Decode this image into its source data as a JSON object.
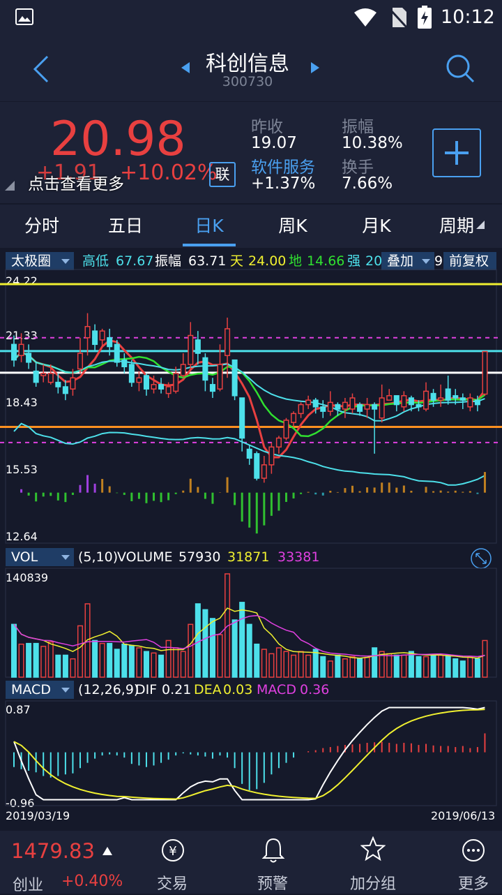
{
  "status": {
    "time": "10:12"
  },
  "header": {
    "title": "科创信息",
    "code": "300730"
  },
  "quote": {
    "price": "20.98",
    "change": "+1.91",
    "change_pct": "+10.02%",
    "hint": "点击查看更多",
    "lian_badge": "联",
    "prev_close_label": "昨收",
    "prev_close": "19.07",
    "amplitude_label": "振幅",
    "amplitude": "10.38%",
    "sector": "软件服务",
    "sector_change": "+1.37%",
    "turnover_label": "换手",
    "turnover": "7.66%"
  },
  "tabs": [
    "分时",
    "五日",
    "日K",
    "周K",
    "月K",
    "周期"
  ],
  "active_tab": "日K",
  "indicator_bar": {
    "selector": "太极圈",
    "hilo_label": "高低",
    "hilo": "67.67",
    "amp_label": "振幅",
    "amp": "63.71",
    "tian_label": "天",
    "tian": "24.00",
    "di_label": "地",
    "di": "14.66",
    "qiang_label": "强",
    "qiang": "20",
    "overlay": "叠加",
    "overlay_tail": "9.",
    "fuquan": "前复权"
  },
  "colors": {
    "up": "#e84040",
    "down": "#4de0ea",
    "accent": "#4aa0f0",
    "bg": "#15192a",
    "panel": "#1d2236"
  },
  "main_chart": {
    "y_labels": [
      "24.22",
      "21.33",
      "18.43",
      "15.53",
      "12.64"
    ],
    "level_lines": [
      {
        "value": 24.0,
        "color": "#f0f030"
      },
      {
        "value": 21.0,
        "color": "#4de0ea"
      },
      {
        "value": 20.03,
        "color": "#ffffff"
      },
      {
        "value": 17.6,
        "color": "#ff9020"
      },
      {
        "value": 21.6,
        "color": "#e040e0",
        "dashed": true
      },
      {
        "value": 16.9,
        "color": "#e040e0",
        "dashed": true
      }
    ],
    "ylim": [
      12.64,
      24.22
    ]
  },
  "volume": {
    "selector": "VOL",
    "params": "(5,10)",
    "label": "VOLUME",
    "value": "57930",
    "ma5": "31871",
    "ma10": "33381",
    "y_top": "140839"
  },
  "macd": {
    "selector": "MACD",
    "params": "(12,26,9)",
    "dif_label": "DIF",
    "dif": "0.21",
    "dea_label": "DEA",
    "dea": "0.03",
    "macd_label": "MACD",
    "macd": "0.36",
    "y_top": "0.87",
    "y_bottom": "-0.96",
    "start_date": "2019/03/19",
    "end_date": "2019/06/13"
  },
  "chart_data": {
    "type": "candlestick",
    "start_date": "2019/03/19",
    "end_date": "2019/06/13",
    "ylim": [
      12.64,
      24.22
    ],
    "candles": [
      [
        21.3,
        20.6,
        21.7,
        20.3
      ],
      [
        20.8,
        21.3,
        21.8,
        20.5
      ],
      [
        20.9,
        20.5,
        21.3,
        20.2
      ],
      [
        20.1,
        19.6,
        20.5,
        19.4
      ],
      [
        19.9,
        20.0,
        20.4,
        19.6
      ],
      [
        19.6,
        20.0,
        20.4,
        19.5
      ],
      [
        19.6,
        19.4,
        20.0,
        19.1
      ],
      [
        19.4,
        19.1,
        19.7,
        18.8
      ],
      [
        19.3,
        19.8,
        20.2,
        19.0
      ],
      [
        20.2,
        20.9,
        21.6,
        20.0
      ],
      [
        21.6,
        22.1,
        22.7,
        20.8
      ],
      [
        21.9,
        21.3,
        22.2,
        21.0
      ],
      [
        21.5,
        21.9,
        22.0,
        21.2
      ],
      [
        21.6,
        21.2,
        22.0,
        20.8
      ],
      [
        21.3,
        20.5,
        21.5,
        20.3
      ],
      [
        20.6,
        20.3,
        20.9,
        20.0
      ],
      [
        20.4,
        19.6,
        20.6,
        19.4
      ],
      [
        19.6,
        19.8,
        20.1,
        19.2
      ],
      [
        19.9,
        19.3,
        20.0,
        19.0
      ],
      [
        19.3,
        19.5,
        19.9,
        19.1
      ],
      [
        19.5,
        19.3,
        19.8,
        19.1
      ],
      [
        19.1,
        19.4,
        19.6,
        18.9
      ],
      [
        19.2,
        20.0,
        20.3,
        19.1
      ],
      [
        19.9,
        20.4,
        20.9,
        19.8
      ],
      [
        20.4,
        21.7,
        22.3,
        20.2
      ],
      [
        21.5,
        20.9,
        21.9,
        20.4
      ],
      [
        20.7,
        19.7,
        20.9,
        19.2
      ],
      [
        19.5,
        19.2,
        19.8,
        18.9
      ],
      [
        19.3,
        20.4,
        21.3,
        19.2
      ],
      [
        20.8,
        22.0,
        22.5,
        19.8
      ],
      [
        20.6,
        19.0,
        20.6,
        18.8
      ],
      [
        18.9,
        17.1,
        18.9,
        16.5
      ],
      [
        16.6,
        16.2,
        16.8,
        15.9
      ],
      [
        16.4,
        15.3,
        16.5,
        15.2
      ],
      [
        15.3,
        15.9,
        16.3,
        15.1
      ],
      [
        15.9,
        16.7,
        16.9,
        15.5
      ],
      [
        16.7,
        17.1,
        17.2,
        16.4
      ],
      [
        17.1,
        17.9,
        18.0,
        17.0
      ],
      [
        17.8,
        18.2,
        18.3,
        17.6
      ],
      [
        18.2,
        18.6,
        18.7,
        18.0
      ],
      [
        18.6,
        18.8,
        19.0,
        18.4
      ],
      [
        18.8,
        18.5,
        18.9,
        18.2
      ],
      [
        18.5,
        18.3,
        18.8,
        18.0
      ],
      [
        18.3,
        18.7,
        19.2,
        18.1
      ],
      [
        18.6,
        18.4,
        18.7,
        18.1
      ],
      [
        18.4,
        18.7,
        18.9,
        18.0
      ],
      [
        18.4,
        18.9,
        19.1,
        18.2
      ],
      [
        18.6,
        18.3,
        18.7,
        18.1
      ],
      [
        18.4,
        18.6,
        18.9,
        18.0
      ],
      [
        18.6,
        18.4,
        18.7,
        16.4
      ],
      [
        18.0,
        18.9,
        19.5,
        17.8
      ],
      [
        18.8,
        19.0,
        19.3,
        18.8
      ],
      [
        19.0,
        18.6,
        19.0,
        18.3
      ],
      [
        18.5,
        19.0,
        19.2,
        18.3
      ],
      [
        18.9,
        18.6,
        19.0,
        18.3
      ],
      [
        18.6,
        18.5,
        18.8,
        18.3
      ],
      [
        18.4,
        19.2,
        19.6,
        18.3
      ],
      [
        19.1,
        18.8,
        19.3,
        18.5
      ],
      [
        18.8,
        18.9,
        19.5,
        18.5
      ],
      [
        19.3,
        18.8,
        19.9,
        18.6
      ],
      [
        19.0,
        18.9,
        19.3,
        18.6
      ],
      [
        18.9,
        18.8,
        19.1,
        18.4
      ],
      [
        18.5,
        18.9,
        19.1,
        18.3
      ],
      [
        18.8,
        18.6,
        19.0,
        18.3
      ],
      [
        19.07,
        20.98,
        20.98,
        19.0
      ]
    ],
    "volume_ylim": [
      0,
      140839
    ],
    "volumes": [
      72000,
      45000,
      46000,
      46000,
      42000,
      48000,
      30000,
      30000,
      25000,
      70000,
      100000,
      50000,
      46000,
      46000,
      38000,
      45000,
      43000,
      40000,
      35000,
      33000,
      30000,
      50000,
      40000,
      35000,
      72000,
      100000,
      92000,
      80000,
      58000,
      140839,
      78000,
      102000,
      72000,
      45000,
      38000,
      32000,
      40000,
      35000,
      30000,
      35000,
      30000,
      38000,
      28000,
      22000,
      30000,
      25000,
      28000,
      25000,
      27000,
      40000,
      35000,
      32000,
      30000,
      30000,
      35000,
      28000,
      28000,
      30000,
      30000,
      30000,
      25000,
      22000,
      28000,
      25000,
      50000
    ],
    "macd_ylim": [
      -0.96,
      0.87
    ],
    "macd_hist": [
      -0.28,
      -0.32,
      -0.35,
      -0.38,
      -0.45,
      -0.48,
      -0.45,
      -0.42,
      -0.4,
      -0.3,
      -0.2,
      -0.12,
      -0.06,
      -0.04,
      -0.06,
      -0.1,
      -0.22,
      -0.25,
      -0.28,
      -0.25,
      -0.2,
      -0.14,
      -0.06,
      -0.02,
      -0.04,
      -0.06,
      -0.08,
      -0.12,
      -0.06,
      -0.1,
      -0.3,
      -0.6,
      -0.72,
      -0.7,
      -0.58,
      -0.42,
      -0.3,
      -0.2,
      -0.1,
      0.0,
      0.02,
      0.04,
      0.08,
      0.1,
      0.12,
      0.14,
      0.15,
      0.16,
      0.18,
      0.19,
      0.2,
      0.18,
      0.16,
      0.18,
      0.17,
      0.14,
      0.16,
      0.13,
      0.12,
      0.12,
      0.1,
      0.12,
      0.08,
      0.1,
      0.36
    ]
  },
  "bottom": {
    "index_value": "1479.83",
    "index_name": "创业",
    "index_change": "+0.40%",
    "nav": [
      "交易",
      "预警",
      "加分组",
      "更多"
    ]
  }
}
